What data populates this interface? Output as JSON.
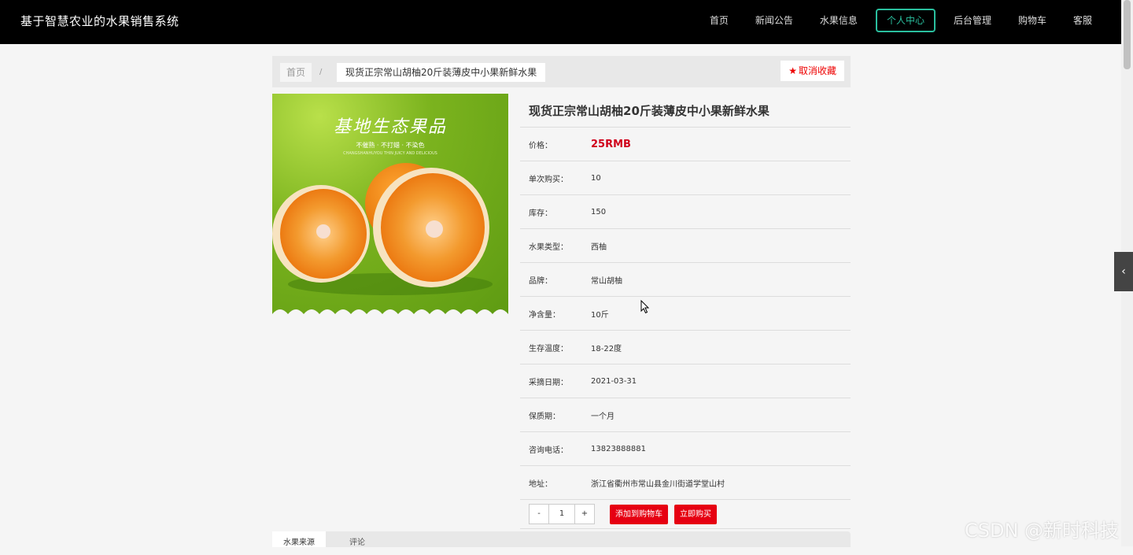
{
  "site": {
    "title": "基于智慧农业的水果销售系统"
  },
  "nav": {
    "items": [
      {
        "label": "首页"
      },
      {
        "label": "新闻公告"
      },
      {
        "label": "水果信息"
      },
      {
        "label": "个人中心",
        "active": true
      },
      {
        "label": "后台管理"
      },
      {
        "label": "购物车"
      },
      {
        "label": "客服"
      }
    ]
  },
  "breadcrumb": {
    "home": "首页",
    "separator": "/",
    "current": "现货正宗常山胡柚20斤装薄皮中小果新鲜水果"
  },
  "favorite": {
    "label": "取消收藏",
    "icon": "star-icon"
  },
  "product_image": {
    "title": "基地生态果品",
    "subtitle": "不催熟 · 不打蜡 · 不染色",
    "subtitle_en": "CHANGSHANHUYOU THIN JUICY AND DELICIOUS"
  },
  "product": {
    "name": "现货正宗常山胡柚20斤装薄皮中小果新鲜水果",
    "fields": [
      {
        "label": "价格：",
        "value": "25RMB"
      },
      {
        "label": "单次购买：",
        "value": "10"
      },
      {
        "label": "库存：",
        "value": "150"
      },
      {
        "label": "水果类型：",
        "value": "西柚"
      },
      {
        "label": "品牌：",
        "value": "常山胡柚"
      },
      {
        "label": "净含量：",
        "value": "10斤"
      },
      {
        "label": "生存温度：",
        "value": "18-22度"
      },
      {
        "label": "采摘日期：",
        "value": "2021-03-31"
      },
      {
        "label": "保质期：",
        "value": "一个月"
      },
      {
        "label": "咨询电话：",
        "value": "13823888881"
      },
      {
        "label": "地址：",
        "value": "浙江省衢州市常山县金川街道学堂山村"
      }
    ]
  },
  "purchase": {
    "minus": "-",
    "quantity": "1",
    "plus": "+",
    "add_to_cart": "添加到购物车",
    "buy_now": "立即购买"
  },
  "tabs": [
    {
      "label": "水果来源",
      "active": true
    },
    {
      "label": "评论"
    }
  ],
  "side_toggle": {
    "icon": "chevron-left-icon",
    "glyph": "‹"
  },
  "watermark": "CSDN @新时科技",
  "colors": {
    "accent": "#2abf9e",
    "price": "#d0021b",
    "button": "#e60012",
    "nav_bg": "#000000"
  }
}
